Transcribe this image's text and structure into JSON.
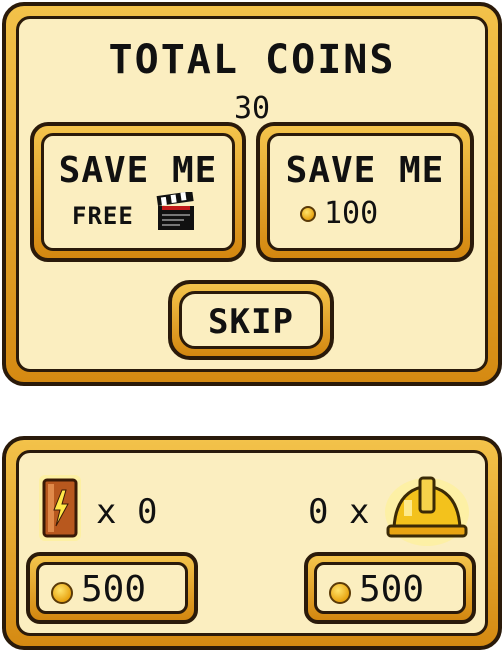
{
  "top_panel": {
    "title": "TOTAL COINS",
    "coins_value": "30"
  },
  "save_free": {
    "label": "SAVE ME",
    "sublabel": "FREE"
  },
  "save_coins": {
    "label": "SAVE ME",
    "price": "100"
  },
  "skip": {
    "label": "SKIP"
  },
  "bottom_panel": {
    "battery": {
      "count": "x 0",
      "price": "500"
    },
    "helmet": {
      "count": "0 x",
      "price": "500"
    }
  },
  "colors": {
    "gold_light": "#f3c24a",
    "gold_dark": "#d58a12",
    "cream": "#fbeec0",
    "outline": "#2a1a0a"
  }
}
